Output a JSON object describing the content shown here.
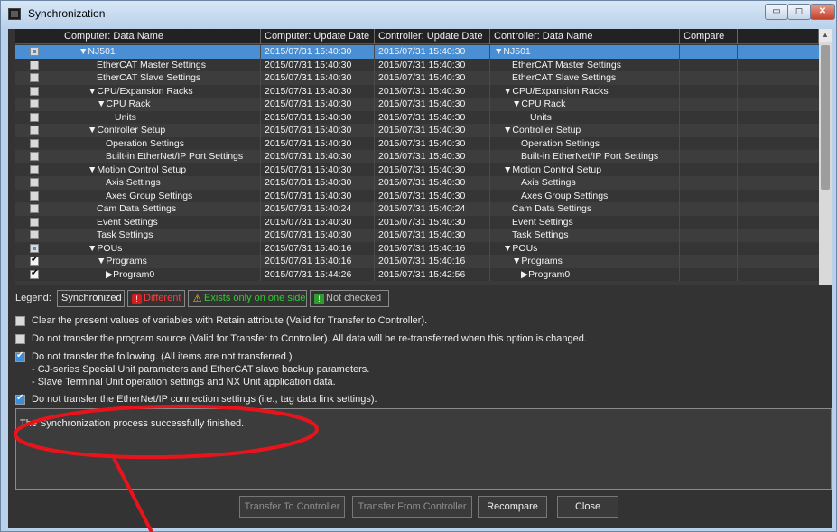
{
  "window": {
    "title": "Synchronization",
    "controls": {
      "minimize": "▭",
      "maximize": "◻",
      "close": "✕"
    }
  },
  "grid": {
    "columns": [
      "Computer: Data Name",
      "Computer: Update Date",
      "Controller: Update Date",
      "Controller: Data Name",
      "Compare"
    ],
    "rows": [
      {
        "checkbox": "dot",
        "indent": 0,
        "arrow": "▼",
        "name": "NJ501",
        "comp_date": "2015/07/31 15:40:30",
        "ctrl_date": "2015/07/31 15:40:30",
        "ctrl_name": "NJ501",
        "selected": true
      },
      {
        "checkbox": "empty",
        "indent": 2,
        "arrow": "",
        "name": "EtherCAT Master Settings",
        "comp_date": "2015/07/31 15:40:30",
        "ctrl_date": "2015/07/31 15:40:30",
        "ctrl_name": "EtherCAT Master Settings"
      },
      {
        "checkbox": "empty",
        "indent": 2,
        "arrow": "",
        "name": "EtherCAT Slave Settings",
        "comp_date": "2015/07/31 15:40:30",
        "ctrl_date": "2015/07/31 15:40:30",
        "ctrl_name": "EtherCAT Slave Settings"
      },
      {
        "checkbox": "empty",
        "indent": 1,
        "arrow": "▼",
        "name": "CPU/Expansion Racks",
        "comp_date": "2015/07/31 15:40:30",
        "ctrl_date": "2015/07/31 15:40:30",
        "ctrl_name": "CPU/Expansion Racks"
      },
      {
        "checkbox": "empty",
        "indent": 2,
        "arrow": "▼",
        "name": "CPU Rack",
        "comp_date": "2015/07/31 15:40:30",
        "ctrl_date": "2015/07/31 15:40:30",
        "ctrl_name": "CPU Rack"
      },
      {
        "checkbox": "empty",
        "indent": 4,
        "arrow": "",
        "name": "Units",
        "comp_date": "2015/07/31 15:40:30",
        "ctrl_date": "2015/07/31 15:40:30",
        "ctrl_name": "Units"
      },
      {
        "checkbox": "empty",
        "indent": 1,
        "arrow": "▼",
        "name": "Controller Setup",
        "comp_date": "2015/07/31 15:40:30",
        "ctrl_date": "2015/07/31 15:40:30",
        "ctrl_name": "Controller Setup"
      },
      {
        "checkbox": "empty",
        "indent": 3,
        "arrow": "",
        "name": "Operation Settings",
        "comp_date": "2015/07/31 15:40:30",
        "ctrl_date": "2015/07/31 15:40:30",
        "ctrl_name": "Operation Settings"
      },
      {
        "checkbox": "empty",
        "indent": 3,
        "arrow": "",
        "name": "Built-in EtherNet/IP Port Settings",
        "comp_date": "2015/07/31 15:40:30",
        "ctrl_date": "2015/07/31 15:40:30",
        "ctrl_name": "Built-in EtherNet/IP Port Settings"
      },
      {
        "checkbox": "empty",
        "indent": 1,
        "arrow": "▼",
        "name": "Motion Control Setup",
        "comp_date": "2015/07/31 15:40:30",
        "ctrl_date": "2015/07/31 15:40:30",
        "ctrl_name": "Motion Control Setup"
      },
      {
        "checkbox": "empty",
        "indent": 3,
        "arrow": "",
        "name": "Axis Settings",
        "comp_date": "2015/07/31 15:40:30",
        "ctrl_date": "2015/07/31 15:40:30",
        "ctrl_name": "Axis Settings"
      },
      {
        "checkbox": "empty",
        "indent": 3,
        "arrow": "",
        "name": "Axes Group Settings",
        "comp_date": "2015/07/31 15:40:30",
        "ctrl_date": "2015/07/31 15:40:30",
        "ctrl_name": "Axes Group Settings"
      },
      {
        "checkbox": "empty",
        "indent": 2,
        "arrow": "",
        "name": "Cam Data Settings",
        "comp_date": "2015/07/31 15:40:24",
        "ctrl_date": "2015/07/31 15:40:24",
        "ctrl_name": "Cam Data Settings"
      },
      {
        "checkbox": "empty",
        "indent": 2,
        "arrow": "",
        "name": "Event Settings",
        "comp_date": "2015/07/31 15:40:30",
        "ctrl_date": "2015/07/31 15:40:30",
        "ctrl_name": "Event Settings"
      },
      {
        "checkbox": "empty",
        "indent": 2,
        "arrow": "",
        "name": "Task Settings",
        "comp_date": "2015/07/31 15:40:30",
        "ctrl_date": "2015/07/31 15:40:30",
        "ctrl_name": "Task Settings"
      },
      {
        "checkbox": "dot",
        "indent": 1,
        "arrow": "▼",
        "name": "POUs",
        "comp_date": "2015/07/31 15:40:16",
        "ctrl_date": "2015/07/31 15:40:16",
        "ctrl_name": "POUs"
      },
      {
        "checkbox": "checked",
        "indent": 2,
        "arrow": "▼",
        "name": "Programs",
        "comp_date": "2015/07/31 15:40:16",
        "ctrl_date": "2015/07/31 15:40:16",
        "ctrl_name": "Programs"
      },
      {
        "checkbox": "checked",
        "indent": 3,
        "arrow": "▶",
        "name": "Program0",
        "comp_date": "2015/07/31 15:44:26",
        "ctrl_date": "2015/07/31 15:42:56",
        "ctrl_name": "Program0"
      }
    ]
  },
  "legend": {
    "label": "Legend:",
    "synchronized": "Synchronized",
    "different": "Different",
    "different_icon": "!",
    "exists_one_side": "Exists only on one side",
    "exists_icon": "⚠",
    "not_checked": "Not checked",
    "not_checked_icon": "!"
  },
  "options": [
    {
      "checked": false,
      "text": "Clear the present values of variables with Retain attribute (Valid for Transfer to Controller)."
    },
    {
      "checked": false,
      "text": "Do not transfer the program source (Valid for Transfer to Controller). All data will be re-transferred when this option is changed."
    },
    {
      "checked": true,
      "text": "Do not transfer the following. (All items are not transferred.)"
    },
    {
      "checked": true,
      "text": "Do not transfer the EtherNet/IP connection settings (i.e., tag data link settings)."
    }
  ],
  "option_sub_lines": [
    "- CJ-series Special Unit parameters and EtherCAT slave backup parameters.",
    "- Slave Terminal Unit operation settings and NX Unit application data."
  ],
  "message": "The Synchronization process successfully finished.",
  "buttons": {
    "transfer_to": "Transfer To Controller",
    "transfer_from": "Transfer From Controller",
    "recompare": "Recompare",
    "close": "Close"
  },
  "annotation_color": "#e8141b"
}
